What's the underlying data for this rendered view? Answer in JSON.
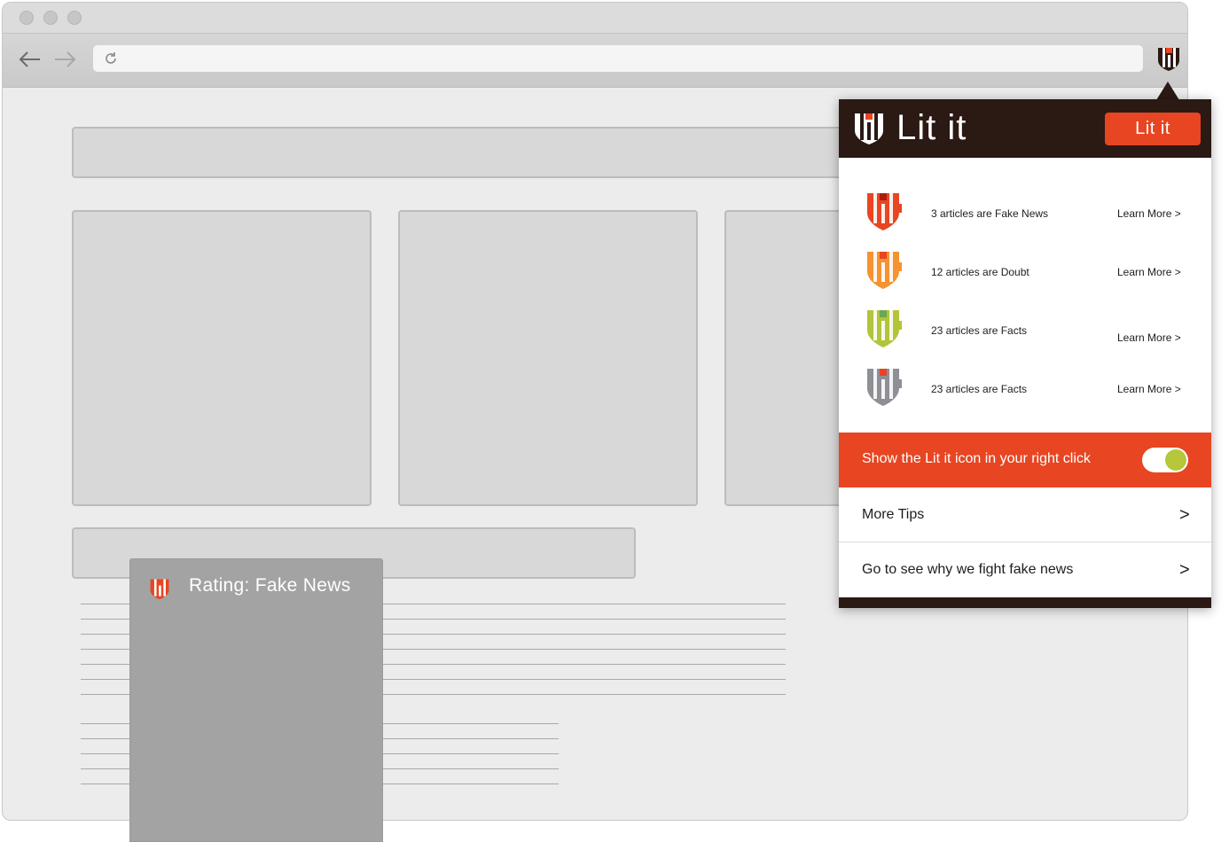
{
  "popup": {
    "brand": "Lit it",
    "action_button": "Lit it",
    "ratings": [
      {
        "text": "3 articles are Fake News",
        "link": "Learn More  >",
        "color": "#e84522",
        "accent": "#ffffff"
      },
      {
        "text": "12 articles are Doubt",
        "link": "Learn More  >",
        "color": "#f59331",
        "accent": "#e84522"
      },
      {
        "text": "23 articles are Facts",
        "link": "Learn More  >",
        "color": "#b3c43a",
        "accent": "#6aa84f"
      },
      {
        "text": "23 articles are Facts",
        "link": "Learn More  >",
        "color": "#8f8f96",
        "accent": "#e84522"
      }
    ],
    "toggle_label": "Show the Lit it icon in your right click",
    "toggle_on": true,
    "menu": [
      {
        "label": "More Tips",
        "chevron": ">"
      },
      {
        "label": "Go to see why we fight fake news",
        "chevron": ">"
      }
    ]
  },
  "tooltip": {
    "text": "Rating: Fake News"
  },
  "colors": {
    "brand_dark": "#2b1914",
    "brand_orange": "#e84522",
    "toggle_green": "#b6c73a"
  },
  "icons": {
    "back": "arrow-left-icon",
    "forward": "arrow-right-icon",
    "reload": "reload-icon",
    "extension": "lit-it-logo-icon"
  }
}
